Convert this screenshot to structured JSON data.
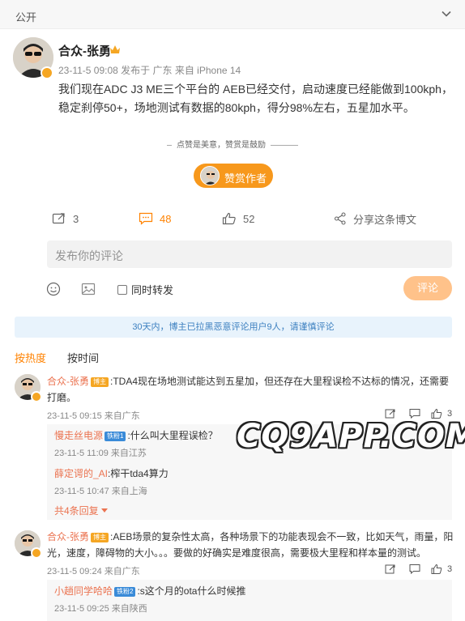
{
  "header": {
    "visibility": "公开",
    "expand_icon": "chevron-down-icon"
  },
  "post": {
    "author": "合众-张勇",
    "meta": "23-11-5 09:08  发布于 广东  来自 iPhone 14",
    "text": "我们现在ADC J3 ME三个平台的 AEB已经交付，启动速度已经能做到100kph，稳定刹停50+，场地测试有数据的80kph，得分98%左右，五星加水平。",
    "tip_hint": "点赞是美意，赞赏是鼓励",
    "tip_button": "赞赏作者",
    "repost_count": "3",
    "comment_count": "48",
    "like_count": "52",
    "share_label": "分享这条博文"
  },
  "composer": {
    "placeholder": "发布你的评论",
    "repost_label": "同时转发",
    "submit_label": "评论"
  },
  "notice": "30天内，博主已拉黑恶意评论用户9人，请谨慎评论",
  "sort": {
    "hot": "按热度",
    "time": "按时间"
  },
  "comments": [
    {
      "name": "合众-张勇",
      "tag": "博主",
      "text": ":TDA4现在场地测试能达到五星加，但还存在大里程误检不达标的情况，还需要打磨。",
      "meta": "23-11-5 09:15 来自广东",
      "likes": "3",
      "replies": [
        {
          "name": "慢走丝电源",
          "tag": "铁粉1",
          "text": ":什么叫大里程误检？",
          "meta": "23-11-5 11:09 来自江苏"
        },
        {
          "name": "薛定谔的_AI",
          "text": ":榨干tda4算力",
          "meta": "23-11-5 10:47 来自上海"
        }
      ],
      "more": "共4条回复"
    },
    {
      "name": "合众-张勇",
      "tag": "博主",
      "text": ":AEB场景的复杂性太高，各种场景下的功能表现会不一致，比如天气，雨量，阳光，速度，障碍物的大小。。。要做的好确实是难度很高，需要极大里程和样本量的测试。",
      "meta": "23-11-5 09:24 来自广东",
      "likes": "3",
      "replies": [
        {
          "name": "小趟同学哈哈",
          "tag": "铁粉2",
          "text": ":s这个月的ota什么时候推",
          "meta": "23-11-5 09:25 来自陕西"
        }
      ]
    }
  ],
  "watermark": "CQ9APP.COM",
  "colors": {
    "accent": "#ff8200",
    "name": "#eb7350",
    "notice_bg": "#e8f3fc"
  }
}
